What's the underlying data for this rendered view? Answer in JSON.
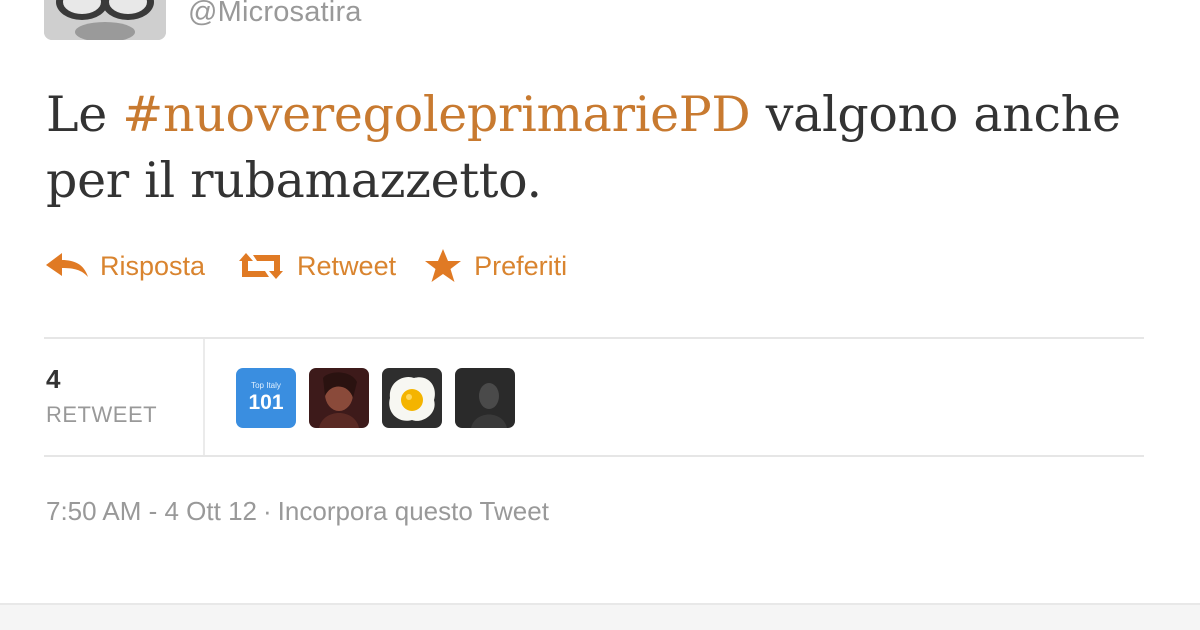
{
  "tweet": {
    "handle": "@Microsatira",
    "text_before": "Le ",
    "hashtag": "#nuoveregoleprimariePD",
    "text_after": " valgono anche per il rubamazzetto."
  },
  "actions": {
    "reply": "Risposta",
    "retweet": "Retweet",
    "favorite": "Preferiti"
  },
  "stats": {
    "retweet_count": "4",
    "retweet_label": "RETWEET",
    "avatar_101_small": "Top Italy",
    "avatar_101_big": "101"
  },
  "meta": {
    "time": "7:50 AM - 4 Ott 12",
    "separator": "·",
    "embed": "Incorpora questo Tweet"
  },
  "colors": {
    "accent": "#d9842f",
    "hashtag": "#c87a30",
    "muted": "#999999",
    "text": "#333333"
  }
}
